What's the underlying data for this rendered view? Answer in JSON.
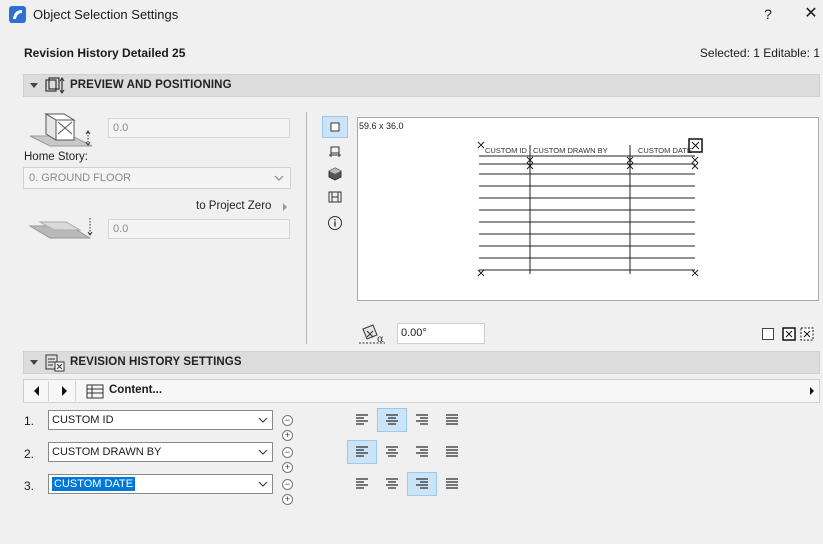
{
  "window": {
    "title": "Object Selection Settings",
    "help": "?",
    "close": "✕"
  },
  "header": {
    "object_name": "Revision History Detailed 25",
    "selection_info": "Selected: 1 Editable: 1"
  },
  "preview_section": {
    "title": "PREVIEW AND POSITIONING",
    "elevation_value": "0.0",
    "home_story_label": "Home Story:",
    "home_story_value": "0. GROUND FLOOR",
    "reference_label": "to Project Zero",
    "offset_value": "0.0",
    "dimensions": "59.6 x 36.0",
    "angle_value": "0.00°",
    "view_buttons": [
      "plan-view",
      "section-view",
      "3d-view",
      "elevation-view",
      "info"
    ]
  },
  "preview_table": {
    "headers": [
      "CUSTOM ID",
      "CUSTOM DRAWN BY",
      "CUSTOM DATE"
    ]
  },
  "revision_section": {
    "title": "REVISION HISTORY SETTINGS",
    "content_label": "Content...",
    "rows": [
      {
        "num": "1.",
        "value": "CUSTOM ID",
        "align": "center"
      },
      {
        "num": "2.",
        "value": "CUSTOM DRAWN BY",
        "align": "left"
      },
      {
        "num": "3.",
        "value": "CUSTOM DATE",
        "align": "right"
      }
    ]
  },
  "colors": {
    "accent": "#0078d7",
    "active_bg": "#cce4f7",
    "section_bg": "#dcdcdc"
  }
}
